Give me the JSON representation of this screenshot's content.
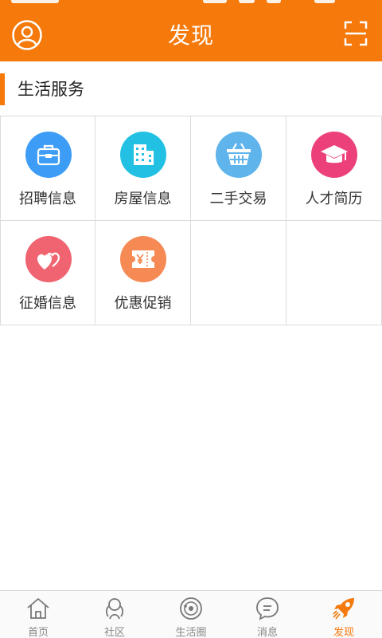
{
  "header": {
    "title": "发现"
  },
  "section": {
    "title": "生活服务"
  },
  "services": [
    {
      "label": "招聘信息",
      "icon": "briefcase-icon",
      "color": "#3d9cf5"
    },
    {
      "label": "房屋信息",
      "icon": "building-icon",
      "color": "#22c1e4"
    },
    {
      "label": "二手交易",
      "icon": "basket-icon",
      "color": "#5fb4ec"
    },
    {
      "label": "人才简历",
      "icon": "graduation-cap-icon",
      "color": "#ec407a"
    },
    {
      "label": "征婚信息",
      "icon": "hearts-icon",
      "color": "#ef6470"
    },
    {
      "label": "优惠促销",
      "icon": "coupon-icon",
      "color": "#f58a55"
    }
  ],
  "tabs": [
    {
      "label": "首页",
      "icon": "home-icon",
      "active": false
    },
    {
      "label": "社区",
      "icon": "community-icon",
      "active": false
    },
    {
      "label": "生活圈",
      "icon": "life-circle-icon",
      "active": false
    },
    {
      "label": "消息",
      "icon": "message-icon",
      "active": false
    },
    {
      "label": "发现",
      "icon": "rocket-icon",
      "active": true
    }
  ],
  "colors": {
    "brand": "#f5790b",
    "tab_inactive": "#888888"
  }
}
